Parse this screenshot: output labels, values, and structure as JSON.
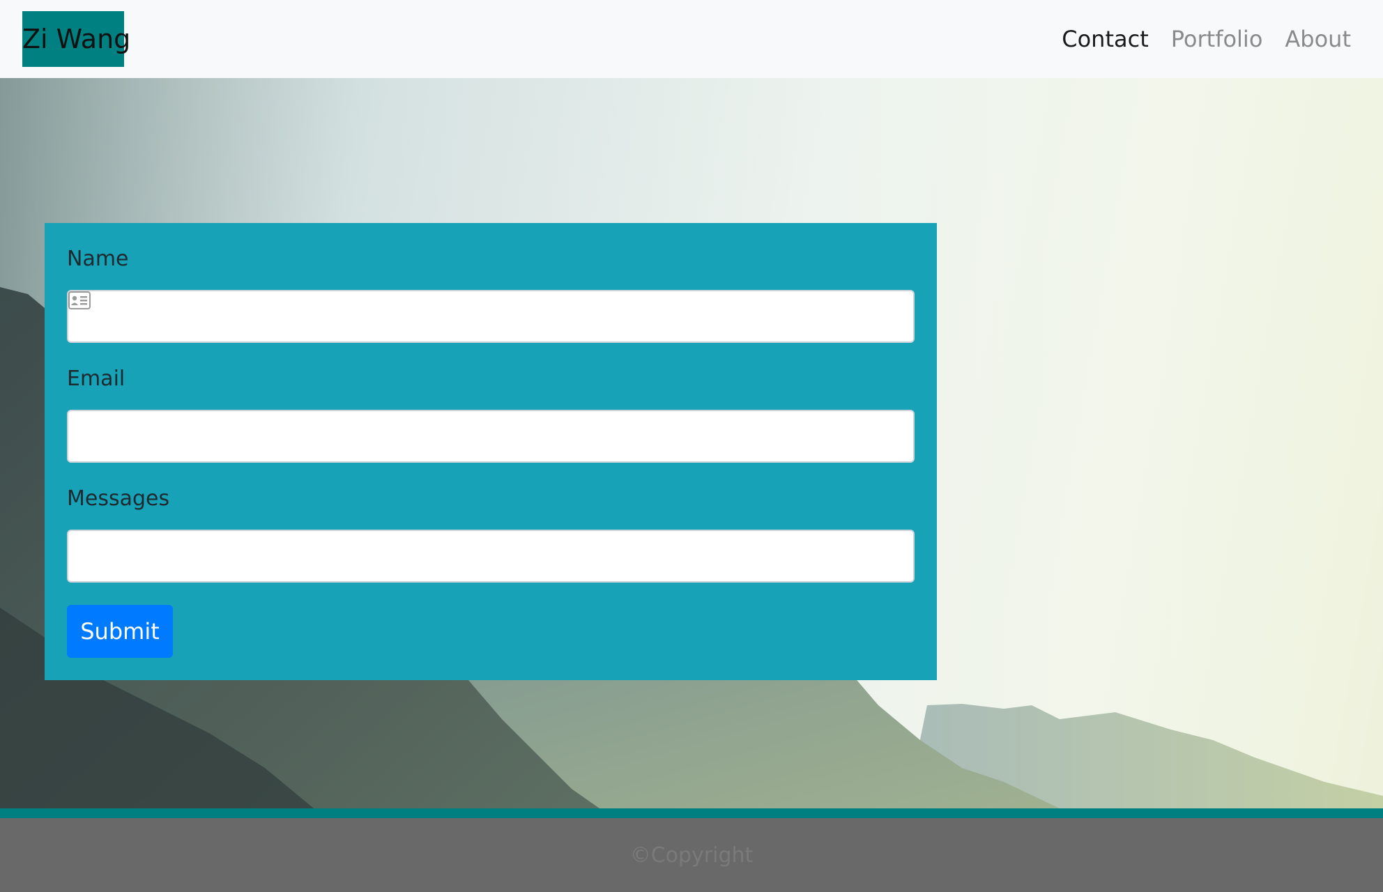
{
  "navbar": {
    "brand": "Zi Wang",
    "links": [
      {
        "label": "Contact",
        "active": true
      },
      {
        "label": "Portfolio",
        "active": false
      },
      {
        "label": "About",
        "active": false
      }
    ]
  },
  "form": {
    "fields": [
      {
        "label": "Name",
        "value": "",
        "icon": "contact-card-icon"
      },
      {
        "label": "Email",
        "value": ""
      },
      {
        "label": "Messages",
        "value": ""
      }
    ],
    "submit_label": "Submit"
  },
  "footer": {
    "copyright": "©Copyright"
  },
  "colors": {
    "brand_bg": "#008080",
    "form_bg": "#17a2b8",
    "submit_bg": "#007bff",
    "footer_bg": "#696969",
    "navbar_bg": "#f8f9fa"
  }
}
